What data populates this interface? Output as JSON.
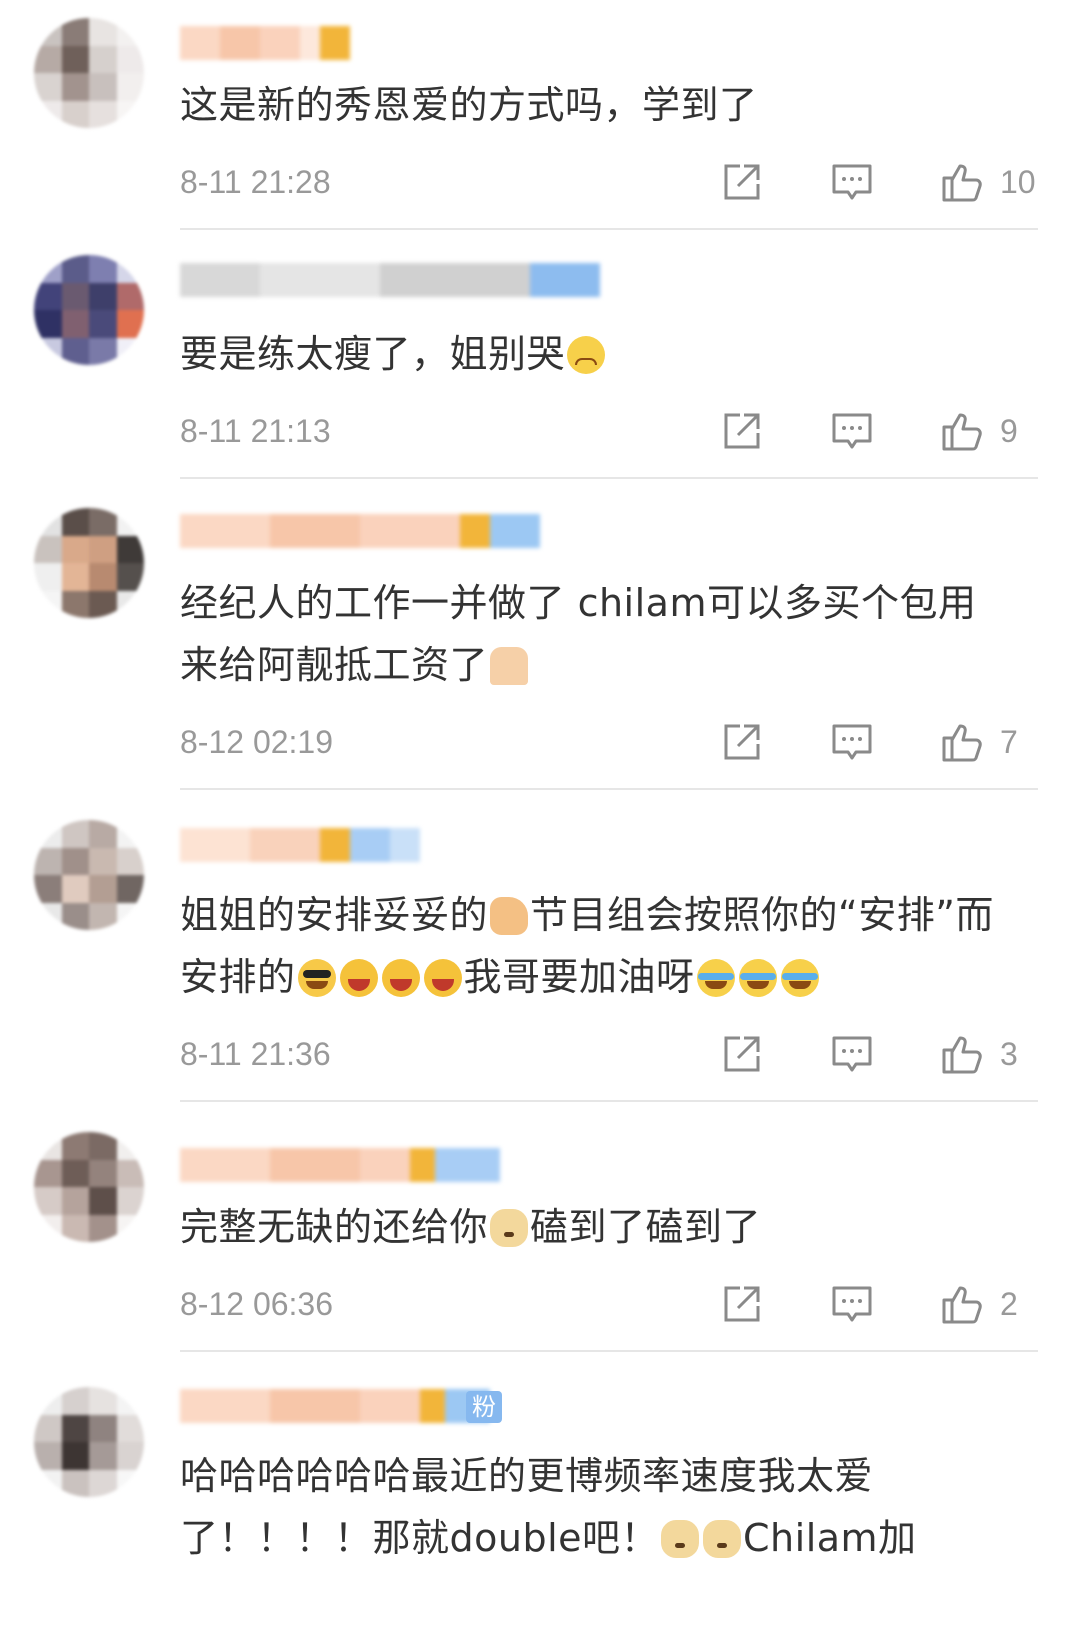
{
  "comments": [
    {
      "text": "这是新的秀恩爱的方式吗，学到了",
      "emoji": [],
      "time": "8-11 21:28",
      "likes": "10"
    },
    {
      "text": "要是练太瘦了，姐别哭",
      "emoji": [
        "cry"
      ],
      "time": "8-11 21:13",
      "likes": "9"
    },
    {
      "text": "经纪人的工作一并做了 chilam可以多买个包用来给阿靓抵工资了",
      "emoji": [
        "pray"
      ],
      "time": "8-12 02:19",
      "likes": "7"
    },
    {
      "text_a": "姐姐的安排妥妥的",
      "text_b": "节目组会按照你的“安排”而安排的",
      "text_c": "我哥要加油呀",
      "time": "8-11 21:36",
      "likes": "3"
    },
    {
      "text_a": "完整无缺的还给你",
      "text_b": "磕到了磕到了",
      "time": "8-12 06:36",
      "likes": "2"
    },
    {
      "text_a": "哈哈哈哈哈哈最近的更博频率速度我太爱了！！！！那就double吧！",
      "text_b": "Chilam加",
      "user_badge": "粉"
    }
  ],
  "icons": {
    "share": "share-icon",
    "reply": "comment-icon",
    "like": "thumbs-up-icon"
  },
  "colors": {
    "text": "#333333",
    "meta": "#999999",
    "divider": "#e6e6e6"
  }
}
